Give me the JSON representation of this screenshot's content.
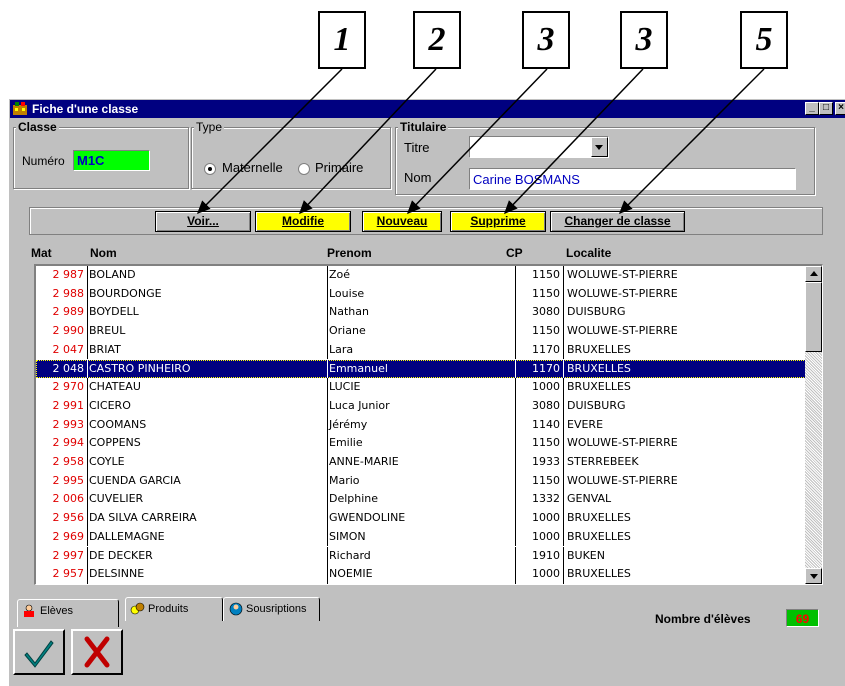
{
  "callouts": [
    "1",
    "2",
    "3",
    "3",
    "5"
  ],
  "window": {
    "title": "Fiche d'une classe",
    "controls": [
      "_",
      "□",
      "×"
    ]
  },
  "classe": {
    "legend": "Classe",
    "numero_label": "Numéro",
    "numero_value": "M1C"
  },
  "type": {
    "legend": "Type",
    "option_maternelle": "Maternelle",
    "option_primaire": "Primaire",
    "selected": "Maternelle"
  },
  "titulaire": {
    "legend": "Titulaire",
    "titre_label": "Titre",
    "titre_value": "",
    "nom_label": "Nom",
    "nom_value": "Carine BOSMANS"
  },
  "toolbar": {
    "voir": "Voir...",
    "modifie": "Modifie",
    "nouveau": "Nouveau",
    "supprime": "Supprime",
    "changer": "Changer de classe"
  },
  "table": {
    "headers": [
      "Mat",
      "Nom",
      "Prenom",
      "CP",
      "Localite"
    ],
    "rows": [
      {
        "mat": "2 987",
        "nom": "BOLAND",
        "prenom": "Zoé",
        "cp": "1150",
        "localite": "WOLUWE-ST-PIERRE"
      },
      {
        "mat": "2 988",
        "nom": "BOURDONGE",
        "prenom": "Louise",
        "cp": "1150",
        "localite": "WOLUWE-ST-PIERRE"
      },
      {
        "mat": "2 989",
        "nom": "BOYDELL",
        "prenom": "Nathan",
        "cp": "3080",
        "localite": "DUISBURG"
      },
      {
        "mat": "2 990",
        "nom": "BREUL",
        "prenom": "Oriane",
        "cp": "1150",
        "localite": "WOLUWE-ST-PIERRE"
      },
      {
        "mat": "2 047",
        "nom": "BRIAT",
        "prenom": "Lara",
        "cp": "1170",
        "localite": "BRUXELLES"
      },
      {
        "mat": "2 048",
        "nom": "CASTRO PINHEIRO",
        "prenom": "Emmanuel",
        "cp": "1170",
        "localite": "BRUXELLES",
        "selected": true
      },
      {
        "mat": "2 970",
        "nom": "CHATEAU",
        "prenom": "LUCIE",
        "cp": "1000",
        "localite": "BRUXELLES"
      },
      {
        "mat": "2 991",
        "nom": "CICERO",
        "prenom": "Luca Junior",
        "cp": "3080",
        "localite": "DUISBURG"
      },
      {
        "mat": "2 993",
        "nom": "COOMANS",
        "prenom": "Jérémy",
        "cp": "1140",
        "localite": "EVERE"
      },
      {
        "mat": "2 994",
        "nom": "COPPENS",
        "prenom": "Emilie",
        "cp": "1150",
        "localite": "WOLUWE-ST-PIERRE"
      },
      {
        "mat": "2 958",
        "nom": "COYLE",
        "prenom": "ANNE-MARIE",
        "cp": "1933",
        "localite": "STERREBEEK"
      },
      {
        "mat": "2 995",
        "nom": "CUENDA GARCIA",
        "prenom": "Mario",
        "cp": "1150",
        "localite": "WOLUWE-ST-PIERRE"
      },
      {
        "mat": "2 006",
        "nom": "CUVELIER",
        "prenom": "Delphine",
        "cp": "1332",
        "localite": "GENVAL"
      },
      {
        "mat": "2 956",
        "nom": "DA SILVA CARREIRA",
        "prenom": "GWENDOLINE",
        "cp": "1000",
        "localite": "BRUXELLES"
      },
      {
        "mat": "2 969",
        "nom": "DALLEMAGNE",
        "prenom": "SIMON",
        "cp": "1000",
        "localite": "BRUXELLES"
      },
      {
        "mat": "2 997",
        "nom": "DE DECKER",
        "prenom": "Richard",
        "cp": "1910",
        "localite": "BUKEN"
      },
      {
        "mat": "2 957",
        "nom": "DELSINNE",
        "prenom": "NOEMIE",
        "cp": "1000",
        "localite": "BRUXELLES"
      }
    ]
  },
  "tabs": [
    {
      "label": "Elèves",
      "icon": "students-icon",
      "active": true
    },
    {
      "label": "Produits",
      "icon": "products-icon",
      "active": false
    },
    {
      "label": "Sousriptions",
      "icon": "subscriptions-icon",
      "active": false
    }
  ],
  "footer": {
    "count_label": "Nombre d'élèves",
    "count_value": "69"
  },
  "colors": {
    "titlebar": "#000080",
    "highlight": "#ffff00",
    "numero_bg": "#00ff00",
    "count_bg": "#00c000",
    "mat_text": "#e00000"
  }
}
